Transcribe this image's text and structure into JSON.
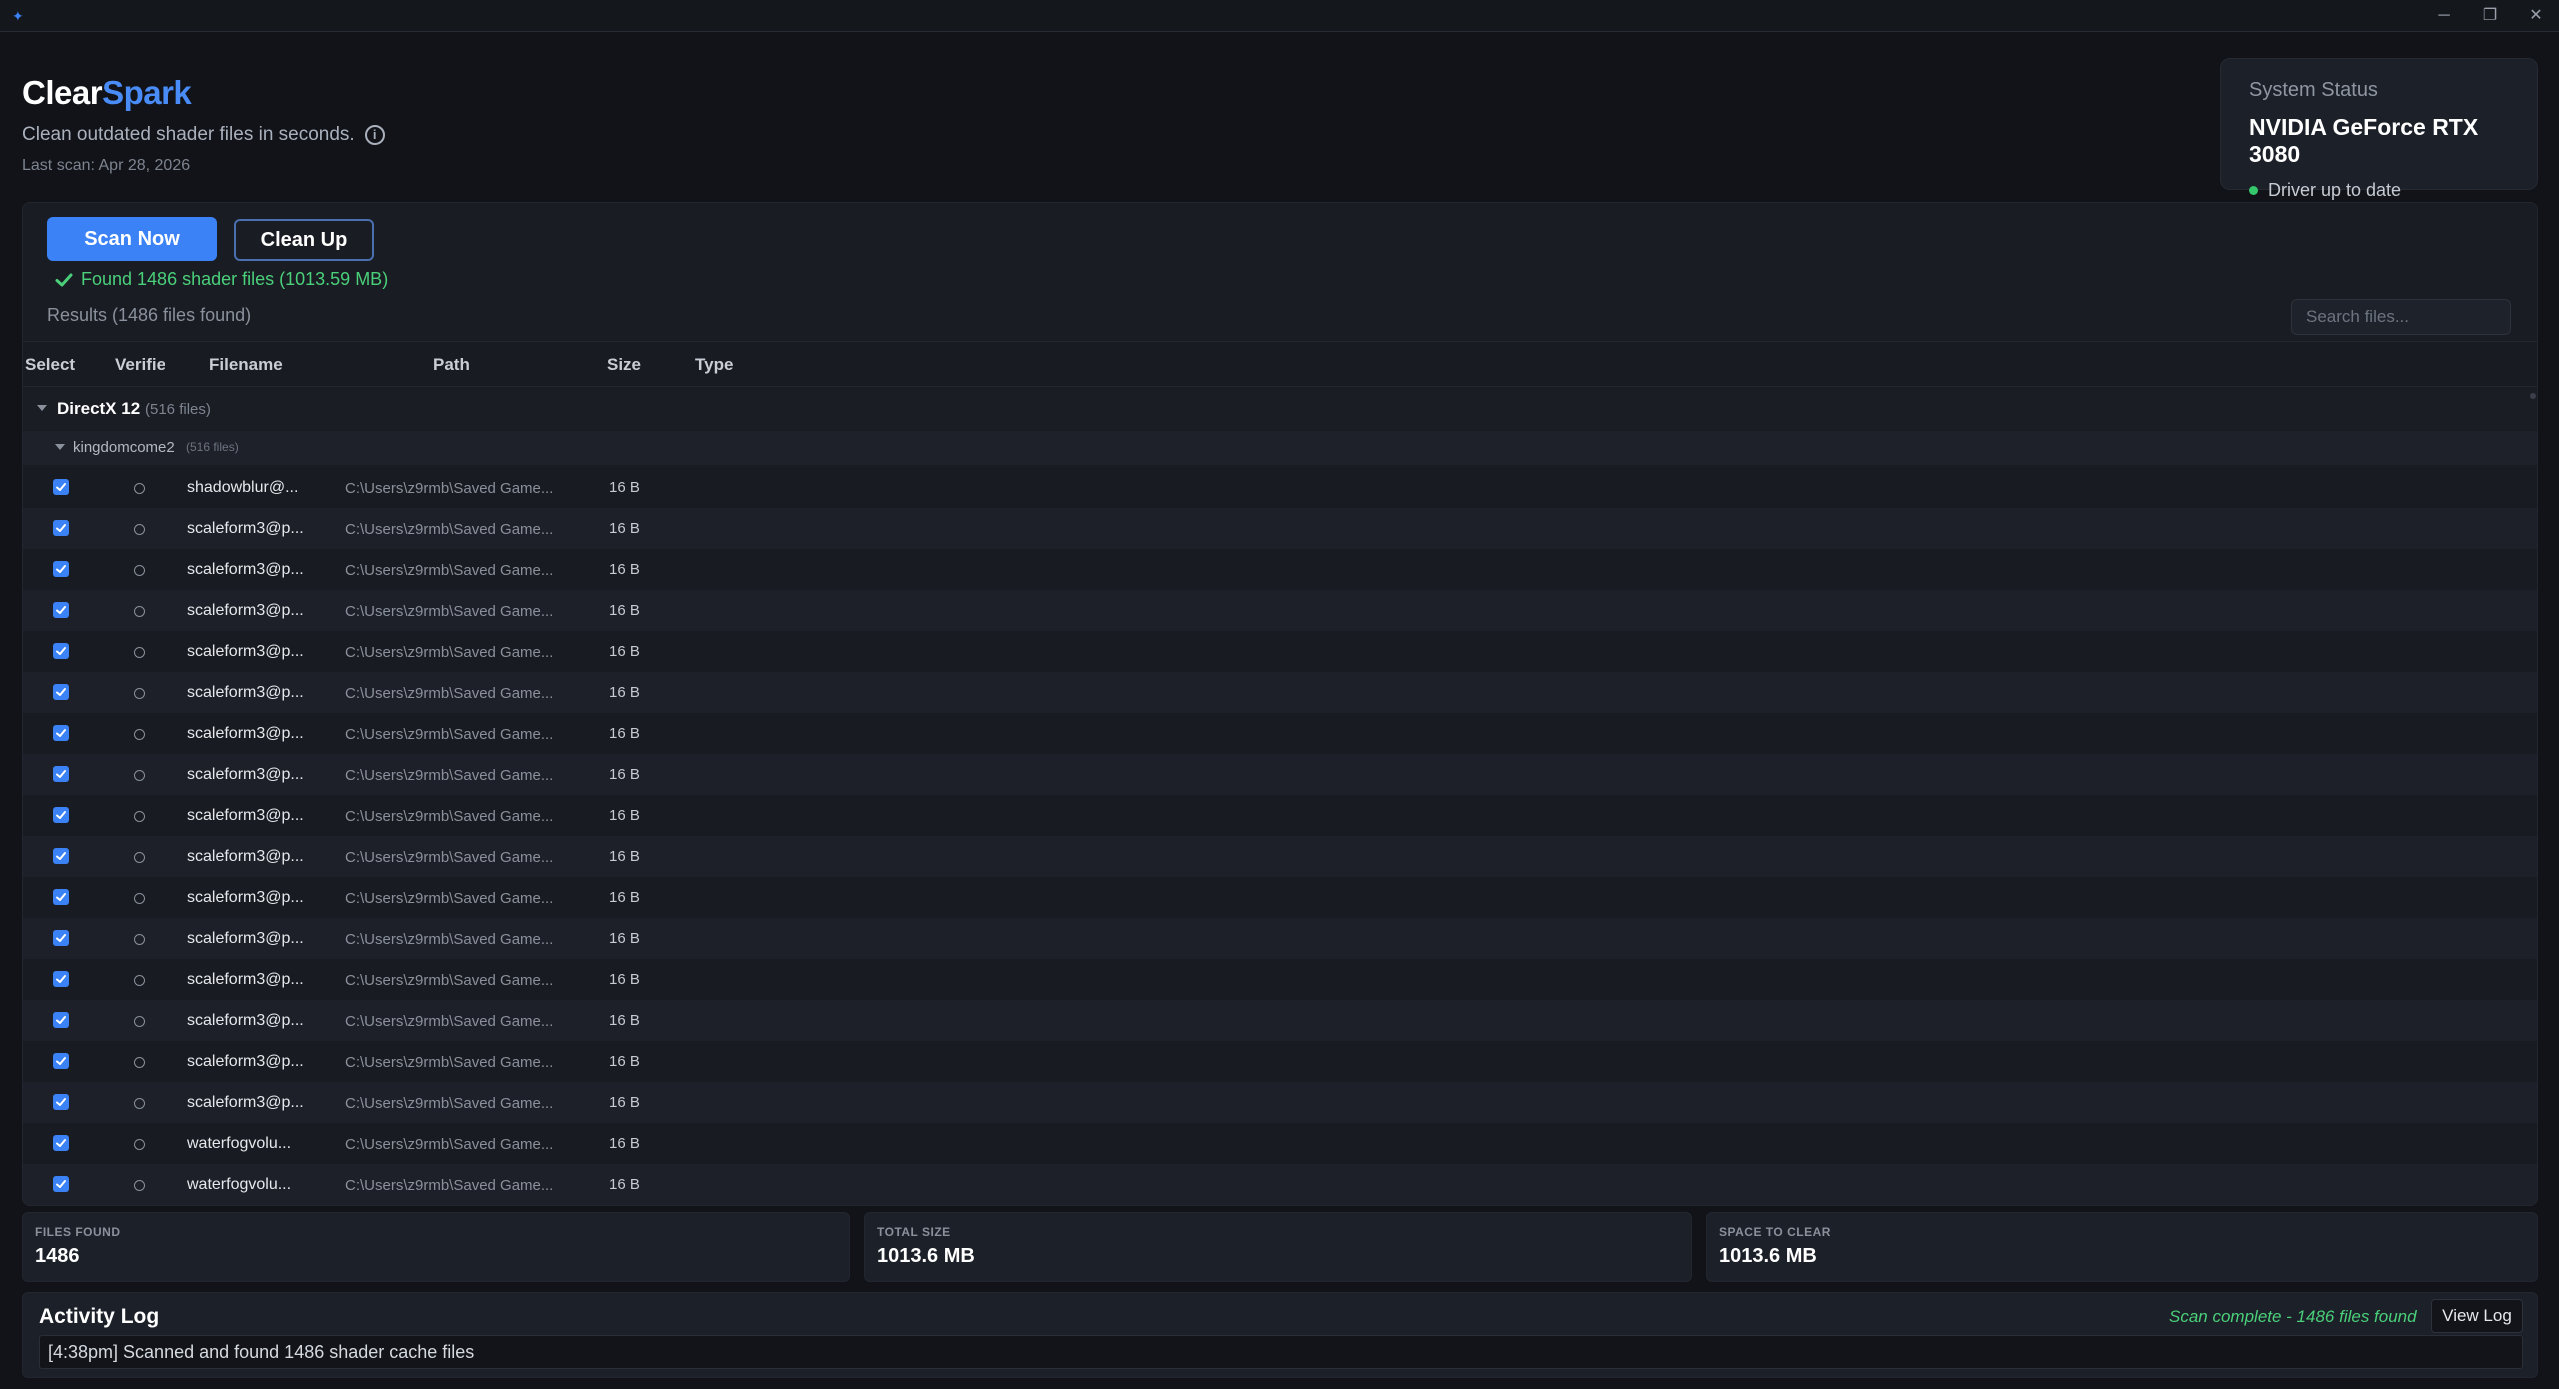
{
  "window": {
    "minimize": "─",
    "restore": "❐",
    "close": "✕"
  },
  "brand": {
    "part1": "Clear",
    "part2": "Spark"
  },
  "tagline": "Clean outdated shader files in seconds.",
  "info_glyph": "i",
  "last_scan": "Last scan: Apr 28, 2026",
  "system_status": {
    "label": "System Status",
    "gpu": "NVIDIA GeForce RTX 3080",
    "driver": "Driver up to date",
    "driver_color": "#34c76b"
  },
  "toolbar": {
    "scan_label": "Scan Now",
    "clean_label": "Clean Up"
  },
  "found_message": "Found 1486 shader files (1013.59 MB)",
  "results_label": "Results (1486 files found)",
  "search": {
    "placeholder": "Search files..."
  },
  "table": {
    "columns": [
      "Select",
      "Verifie",
      "Filename",
      "Path",
      "Size",
      "Type"
    ],
    "group": {
      "name": "DirectX 12",
      "count": "(516 files)"
    },
    "subgroup": {
      "name": "kingdomcome2",
      "count": "(516 files)"
    },
    "rows": [
      {
        "filename": "shadowblur@...",
        "path": "C:\\Users\\z9rmb\\Saved Game...",
        "size": "16 B"
      },
      {
        "filename": "scaleform3@p...",
        "path": "C:\\Users\\z9rmb\\Saved Game...",
        "size": "16 B"
      },
      {
        "filename": "scaleform3@p...",
        "path": "C:\\Users\\z9rmb\\Saved Game...",
        "size": "16 B"
      },
      {
        "filename": "scaleform3@p...",
        "path": "C:\\Users\\z9rmb\\Saved Game...",
        "size": "16 B"
      },
      {
        "filename": "scaleform3@p...",
        "path": "C:\\Users\\z9rmb\\Saved Game...",
        "size": "16 B"
      },
      {
        "filename": "scaleform3@p...",
        "path": "C:\\Users\\z9rmb\\Saved Game...",
        "size": "16 B"
      },
      {
        "filename": "scaleform3@p...",
        "path": "C:\\Users\\z9rmb\\Saved Game...",
        "size": "16 B"
      },
      {
        "filename": "scaleform3@p...",
        "path": "C:\\Users\\z9rmb\\Saved Game...",
        "size": "16 B"
      },
      {
        "filename": "scaleform3@p...",
        "path": "C:\\Users\\z9rmb\\Saved Game...",
        "size": "16 B"
      },
      {
        "filename": "scaleform3@p...",
        "path": "C:\\Users\\z9rmb\\Saved Game...",
        "size": "16 B"
      },
      {
        "filename": "scaleform3@p...",
        "path": "C:\\Users\\z9rmb\\Saved Game...",
        "size": "16 B"
      },
      {
        "filename": "scaleform3@p...",
        "path": "C:\\Users\\z9rmb\\Saved Game...",
        "size": "16 B"
      },
      {
        "filename": "scaleform3@p...",
        "path": "C:\\Users\\z9rmb\\Saved Game...",
        "size": "16 B"
      },
      {
        "filename": "scaleform3@p...",
        "path": "C:\\Users\\z9rmb\\Saved Game...",
        "size": "16 B"
      },
      {
        "filename": "scaleform3@p...",
        "path": "C:\\Users\\z9rmb\\Saved Game...",
        "size": "16 B"
      },
      {
        "filename": "scaleform3@p...",
        "path": "C:\\Users\\z9rmb\\Saved Game...",
        "size": "16 B"
      },
      {
        "filename": "waterfogvolu...",
        "path": "C:\\Users\\z9rmb\\Saved Game...",
        "size": "16 B"
      },
      {
        "filename": "waterfogvolu...",
        "path": "C:\\Users\\z9rmb\\Saved Game...",
        "size": "16 B"
      }
    ]
  },
  "stats": [
    {
      "label": "FILES FOUND",
      "value": "1486"
    },
    {
      "label": "TOTAL SIZE",
      "value": "1013.6 MB"
    },
    {
      "label": "SPACE TO CLEAR",
      "value": "1013.6 MB"
    }
  ],
  "activity": {
    "title": "Activity Log",
    "status": "Scan complete - 1486 files found",
    "view_log_label": "View Log",
    "entries": [
      "[4:38pm] Scanned and found 1486 shader cache files"
    ]
  },
  "colors": {
    "accent": "#3b82f6",
    "success": "#4ad07a",
    "background": "#111318"
  }
}
